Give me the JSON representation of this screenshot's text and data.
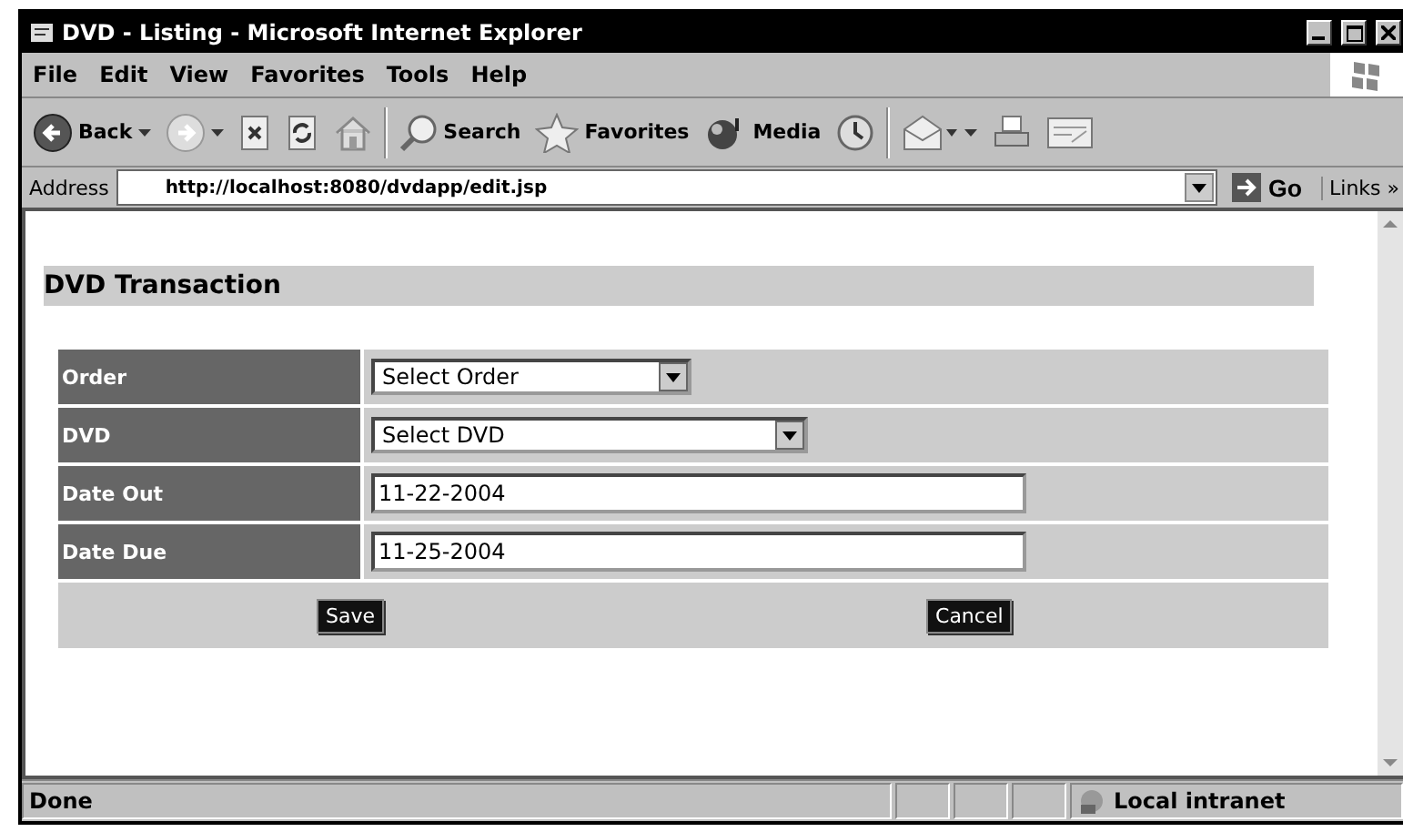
{
  "window": {
    "title": "DVD - Listing - Microsoft Internet Explorer"
  },
  "menu": [
    "File",
    "Edit",
    "View",
    "Favorites",
    "Tools",
    "Help"
  ],
  "toolbar": [
    {
      "kind": "back",
      "label": "Back"
    },
    {
      "kind": "forward"
    },
    {
      "kind": "stop"
    },
    {
      "kind": "refresh"
    },
    {
      "kind": "home"
    },
    {
      "kind": "search",
      "label": "Search"
    },
    {
      "kind": "favorites",
      "label": "Favorites"
    },
    {
      "kind": "media",
      "label": "Media"
    },
    {
      "kind": "history"
    },
    {
      "kind": "mail"
    },
    {
      "kind": "print"
    },
    {
      "kind": "edit"
    }
  ],
  "address": {
    "label": "Address",
    "url": "http://localhost:8080/dvdapp/edit.jsp",
    "go": "Go",
    "links": "Links »"
  },
  "page": {
    "heading": "DVD Transaction",
    "rows": [
      {
        "label": "Order",
        "kind": "select",
        "value": "Select Order"
      },
      {
        "label": "DVD",
        "kind": "select",
        "value": "Select DVD"
      },
      {
        "label": "Date Out",
        "kind": "text",
        "value": "11-22-2004"
      },
      {
        "label": "Date Due",
        "kind": "text",
        "value": "11-25-2004"
      }
    ],
    "buttons": [
      "Save",
      "Cancel"
    ]
  },
  "status_bar": {
    "text": "Done",
    "zone": "Local intranet"
  }
}
